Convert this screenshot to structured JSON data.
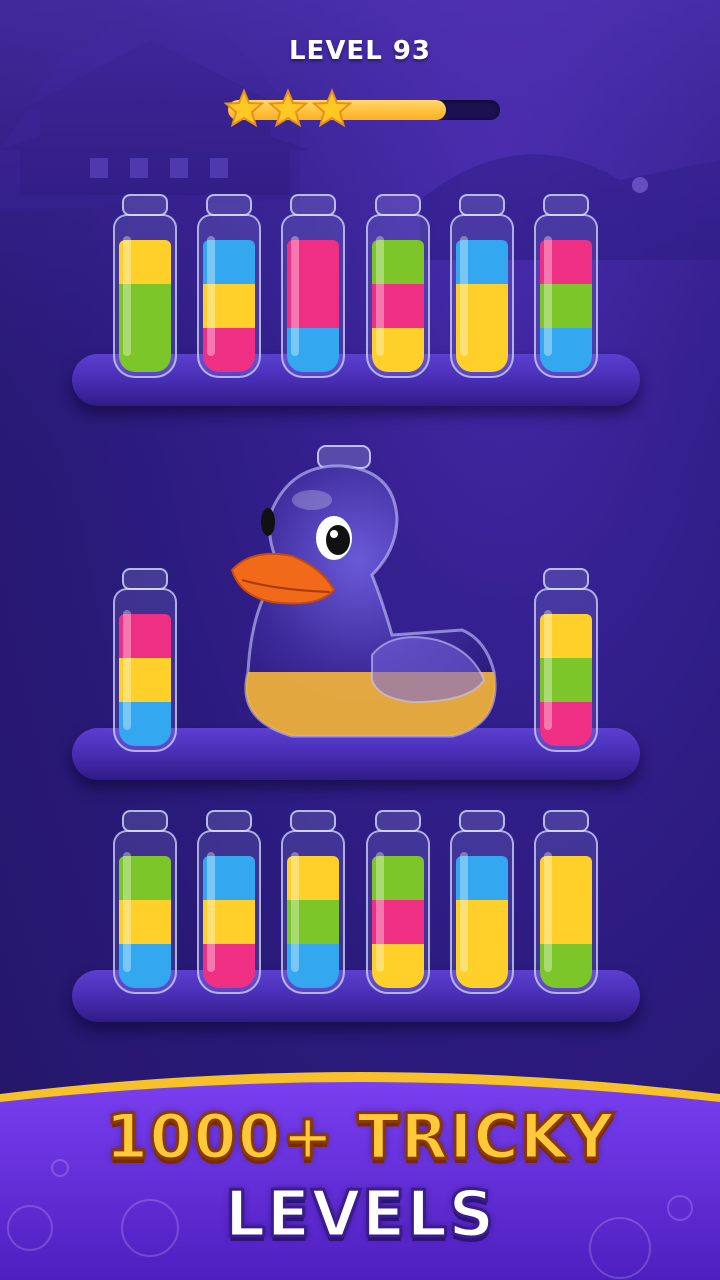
{
  "hud": {
    "level_label": "LEVEL 93",
    "stars_earned": 3,
    "progress_fraction": 0.8
  },
  "colors": {
    "yellow": "#ffcf2a",
    "green": "#7cc62a",
    "blue": "#33a8f0",
    "pink": "#ee2f84",
    "duck_liquid": "#f2b33a"
  },
  "shelves": [
    {
      "tubes": [
        [
          "green",
          "green",
          "yellow"
        ],
        [
          "pink",
          "yellow",
          "blue"
        ],
        [
          "blue",
          "pink",
          "pink"
        ],
        [
          "yellow",
          "pink",
          "green"
        ],
        [
          "yellow",
          "yellow",
          "blue"
        ],
        [
          "blue",
          "green",
          "pink"
        ]
      ]
    },
    {
      "tubes": [
        [
          "blue",
          "yellow",
          "pink"
        ],
        [
          "pink",
          "green",
          "yellow"
        ]
      ]
    },
    {
      "tubes": [
        [
          "blue",
          "yellow",
          "green"
        ],
        [
          "pink",
          "yellow",
          "blue"
        ],
        [
          "blue",
          "green",
          "yellow"
        ],
        [
          "yellow",
          "pink",
          "green"
        ],
        [
          "yellow",
          "yellow",
          "blue"
        ],
        [
          "green",
          "yellow",
          "yellow"
        ]
      ]
    }
  ],
  "banner": {
    "line1": "1000+ TRICKY",
    "line2": "LEVELS"
  },
  "icons": {
    "star": "star-icon",
    "duck": "duck-bottle-icon"
  }
}
